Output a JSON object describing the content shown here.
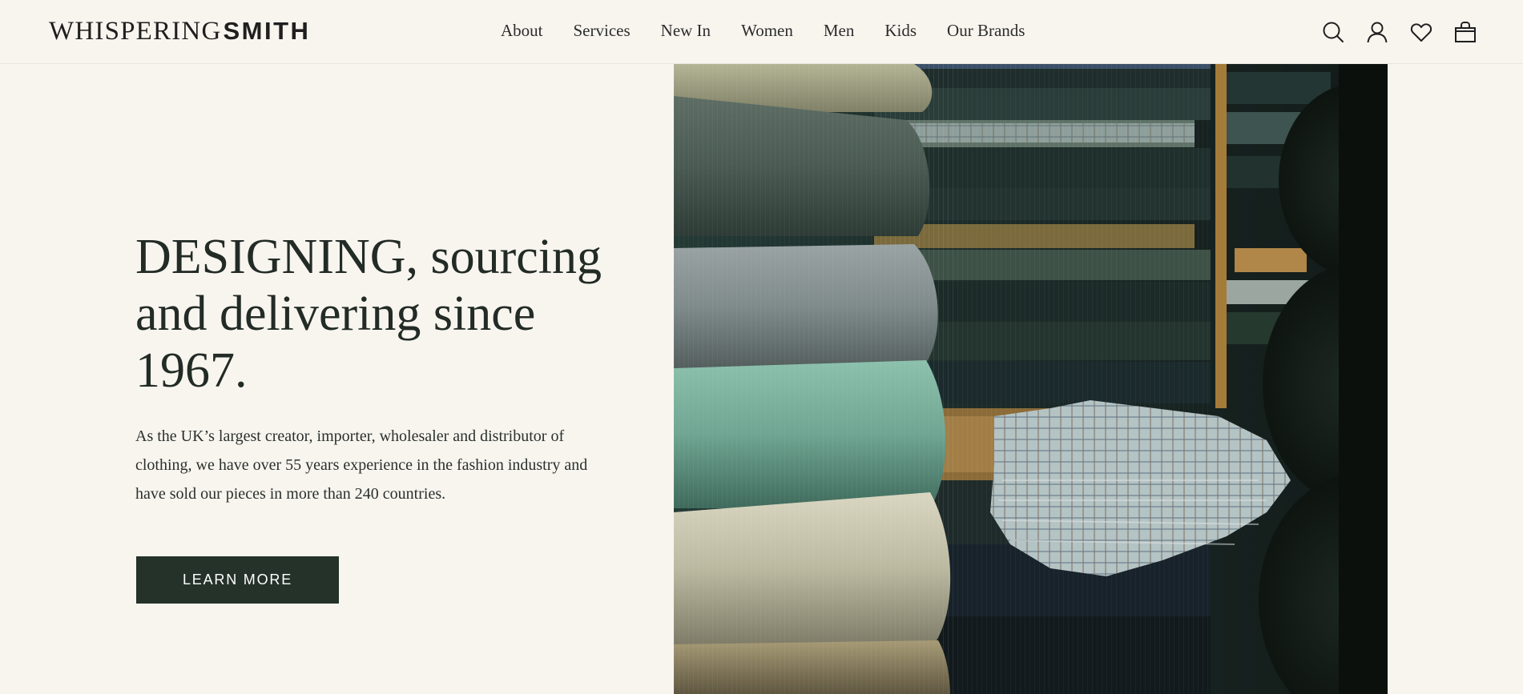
{
  "brand": {
    "name_light": "WHISPERING",
    "name_bold": "SMITH"
  },
  "nav": {
    "items": [
      {
        "label": "About"
      },
      {
        "label": "Services"
      },
      {
        "label": "New In"
      },
      {
        "label": "Women"
      },
      {
        "label": "Men"
      },
      {
        "label": "Kids"
      },
      {
        "label": "Our Brands"
      }
    ]
  },
  "header_icons": [
    "search-icon",
    "account-icon",
    "wishlist-icon",
    "bag-icon"
  ],
  "hero": {
    "title": "DESIGNING, sourcing and delivering since 1967.",
    "body": "As the UK’s largest creator, importer, wholesaler and distributor of clothing, we have over 55 years experience in the fashion industry and have sold our pieces in more than 240 countries.",
    "cta_label": "LEARN MORE"
  },
  "colors": {
    "background": "#f8f5ef",
    "text": "#232b26",
    "button": "#253229"
  }
}
